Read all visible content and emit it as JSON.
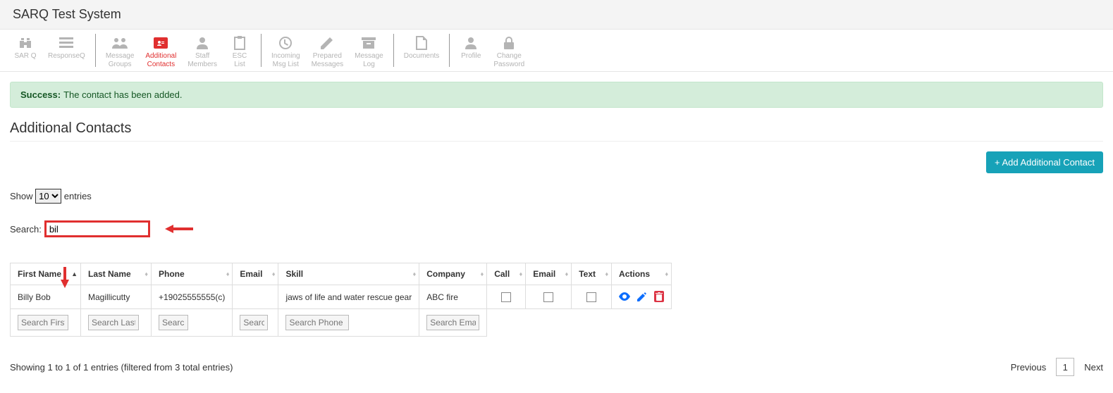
{
  "brand": "SARQ Test System",
  "toolbar": [
    {
      "id": "sarq",
      "label": "SAR Q",
      "icon": "binoculars"
    },
    {
      "id": "responseq",
      "label": "ResponseQ",
      "icon": "list"
    },
    {
      "id": "msggroups",
      "label": "Message\nGroups",
      "icon": "users"
    },
    {
      "id": "addcontacts",
      "label": "Additional\nContacts",
      "icon": "idcard",
      "active": true
    },
    {
      "id": "staff",
      "label": "Staff\nMembers",
      "icon": "user"
    },
    {
      "id": "esclist",
      "label": "ESC\nList",
      "icon": "clipboard"
    },
    {
      "id": "incoming",
      "label": "Incoming\nMsg List",
      "icon": "inbox"
    },
    {
      "id": "prepared",
      "label": "Prepared\nMessages",
      "icon": "pencil"
    },
    {
      "id": "msglog",
      "label": "Message\nLog",
      "icon": "archive"
    },
    {
      "id": "documents",
      "label": "Documents",
      "icon": "doc"
    },
    {
      "id": "profile",
      "label": "Profile",
      "icon": "person"
    },
    {
      "id": "password",
      "label": "Change\nPassword",
      "icon": "lock"
    }
  ],
  "alert": {
    "strong": "Success:",
    "text": "The contact has been added."
  },
  "page_title": "Additional Contacts",
  "add_btn": "+ Add Additional Contact",
  "show": {
    "pre": "Show",
    "value": "10",
    "post": "entries"
  },
  "search": {
    "label": "Search:",
    "value": "bil"
  },
  "columns": {
    "first": "First Name",
    "last": "Last Name",
    "phone": "Phone",
    "email": "Email",
    "skill": "Skill",
    "company": "Company",
    "call": "Call",
    "cemail": "Email",
    "text": "Text",
    "actions": "Actions"
  },
  "row": {
    "first": "Billy Bob",
    "last": "Magillicutty",
    "phone": "+19025555555(c)",
    "email": "",
    "skill": "jaws of life and water rescue gear",
    "company": "ABC fire"
  },
  "filters": {
    "first": "Search First",
    "last": "Search Last",
    "phone": "Search",
    "email": "Search",
    "skill": "Search Phone",
    "company": "Search Email"
  },
  "footer": "Showing 1 to 1 of 1 entries (filtered from 3 total entries)",
  "pager": {
    "prev": "Previous",
    "page": "1",
    "next": "Next"
  }
}
